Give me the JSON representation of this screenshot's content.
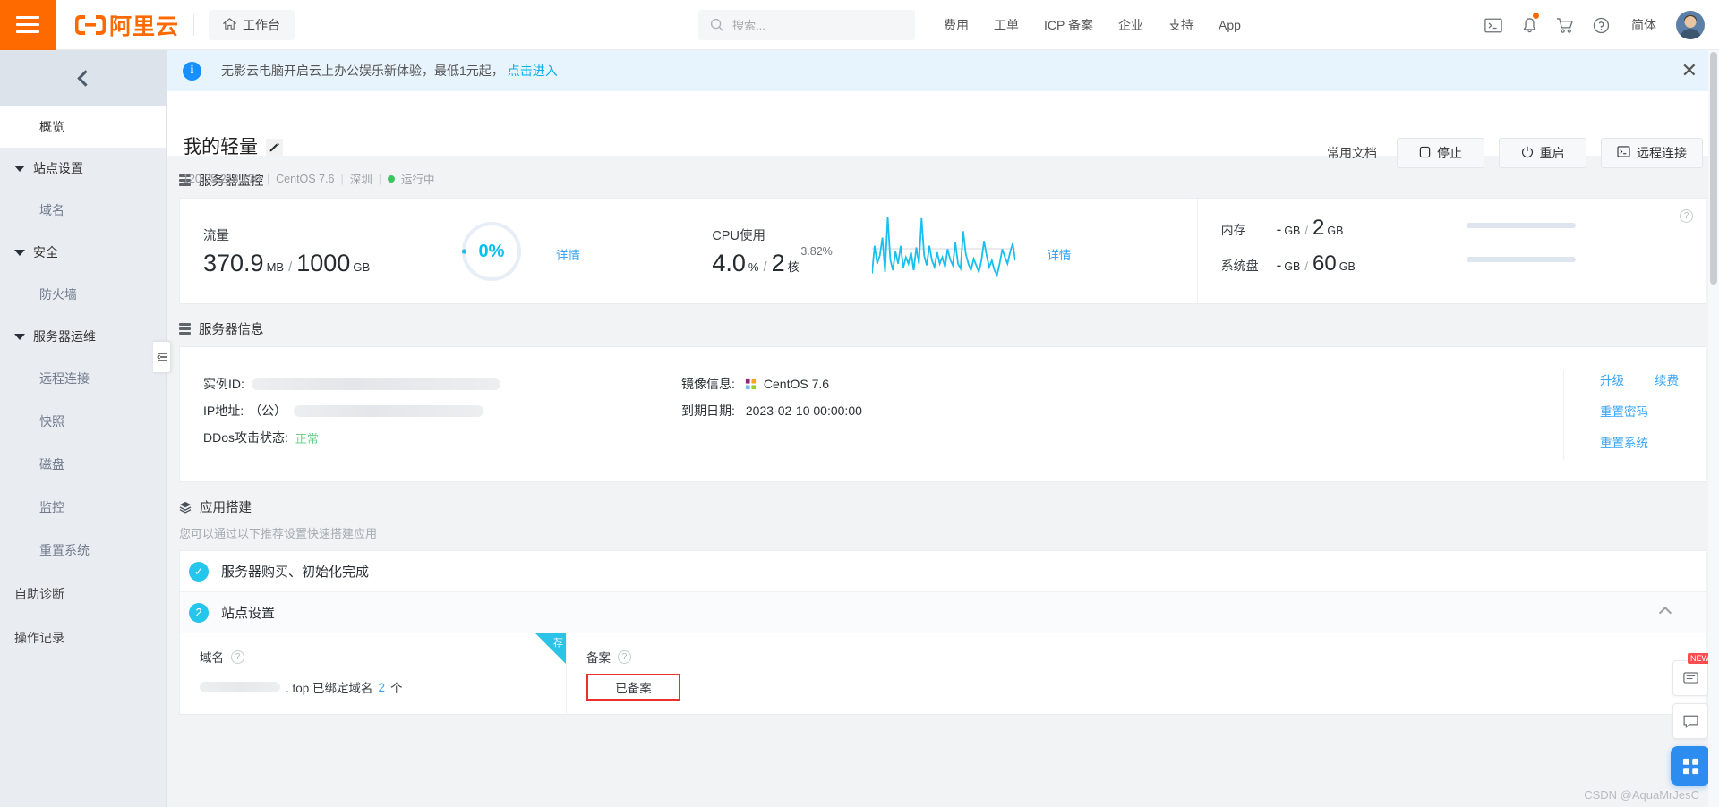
{
  "topbar": {
    "logo_text": "阿里云",
    "workbench": "工作台",
    "search_placeholder": "搜索...",
    "nav": [
      "费用",
      "工单",
      "ICP 备案",
      "企业",
      "支持",
      "App"
    ],
    "lang": "简体",
    "icons": [
      "console-icon",
      "bell-icon",
      "cart-icon",
      "help-icon"
    ]
  },
  "sidebar": {
    "collapse": "collapse-icon",
    "overview": "概览",
    "groups": [
      {
        "label": "站点设置",
        "items": [
          "域名"
        ]
      },
      {
        "label": "安全",
        "items": [
          "防火墙"
        ]
      },
      {
        "label": "服务器运维",
        "items": [
          "远程连接",
          "快照",
          "磁盘",
          "监控",
          "重置系统"
        ]
      }
    ],
    "standalone": [
      "自助诊断",
      "操作记录"
    ]
  },
  "banner": {
    "text": "无影云电脑开启云上办公娱乐新体验，最低1元起，",
    "link": "点击进入",
    "close": "✕"
  },
  "page_header": {
    "title": "我的轻量",
    "edit_icon": "✎",
    "ip": "120.25.218.170",
    "os": "CentOS 7.6",
    "region": "深圳",
    "status": "运行中",
    "docs_link": "常用文档",
    "buttons": [
      {
        "label": "停止",
        "icon": "stop-icon"
      },
      {
        "label": "重启",
        "icon": "power-icon"
      },
      {
        "label": "远程连接",
        "icon": "terminal-icon"
      }
    ]
  },
  "monitor": {
    "section_title": "服务器监控",
    "traffic": {
      "label": "流量",
      "used": "370.9",
      "used_unit": "MB",
      "total": "1000",
      "total_unit": "GB",
      "percent": "0%",
      "detail": "详情"
    },
    "cpu": {
      "label": "CPU使用",
      "used": "4.0",
      "used_unit": "%",
      "total": "2",
      "total_unit": "核",
      "current": "3.82%",
      "detail": "详情"
    },
    "memory": {
      "label": "内存",
      "used": "-",
      "used_unit": "GB",
      "total": "2",
      "total_unit": "GB"
    },
    "disk": {
      "label": "系统盘",
      "used": "-",
      "used_unit": "GB",
      "total": "60",
      "total_unit": "GB"
    }
  },
  "server_info": {
    "section_title": "服务器信息",
    "instance_id_label": "实例ID:",
    "ip_label": "IP地址:",
    "ip_prefix": "（公）",
    "ddos_label": "DDos攻击状态:",
    "ddos_value": "正常",
    "image_label": "镜像信息:",
    "image_value": "CentOS 7.6",
    "expire_label": "到期日期:",
    "expire_value": "2023-02-10 00:00:00",
    "links": [
      "升级",
      "续费",
      "重置密码",
      "重置系统"
    ]
  },
  "app_build": {
    "section_title": "应用搭建",
    "description": "您可以通过以下推荐设置快速搭建应用",
    "steps": [
      {
        "badge": "✓",
        "label": "服务器购买、初始化完成"
      },
      {
        "badge": "2",
        "label": "站点设置"
      }
    ],
    "domain": {
      "head": "域名",
      "ribbon": "荐",
      "suffix": ". top 已绑定域名",
      "count": "2",
      "count_unit": "个"
    },
    "beian": {
      "head": "备案",
      "status": "已备案"
    }
  },
  "floats": {
    "new_tag": "NEW",
    "buttons": [
      "feedback-icon",
      "chat-icon",
      "apps-icon"
    ]
  },
  "watermark": "CSDN @AquaMrJesC",
  "chart_data": {
    "type": "line",
    "title": "CPU使用",
    "ylabel": "%",
    "annotation": "3.82%",
    "values": [
      18,
      52,
      30,
      40,
      62,
      20,
      88,
      35,
      22,
      45,
      30,
      52,
      25,
      38,
      30,
      44,
      22,
      50,
      30,
      86,
      40,
      28,
      52,
      34,
      26,
      44,
      30,
      38,
      26,
      48,
      35,
      28,
      56,
      30,
      24,
      70,
      42,
      30,
      22,
      36,
      28,
      20,
      34,
      58,
      40,
      26,
      34,
      22,
      16,
      30,
      48,
      38,
      30,
      44,
      55,
      34
    ]
  }
}
